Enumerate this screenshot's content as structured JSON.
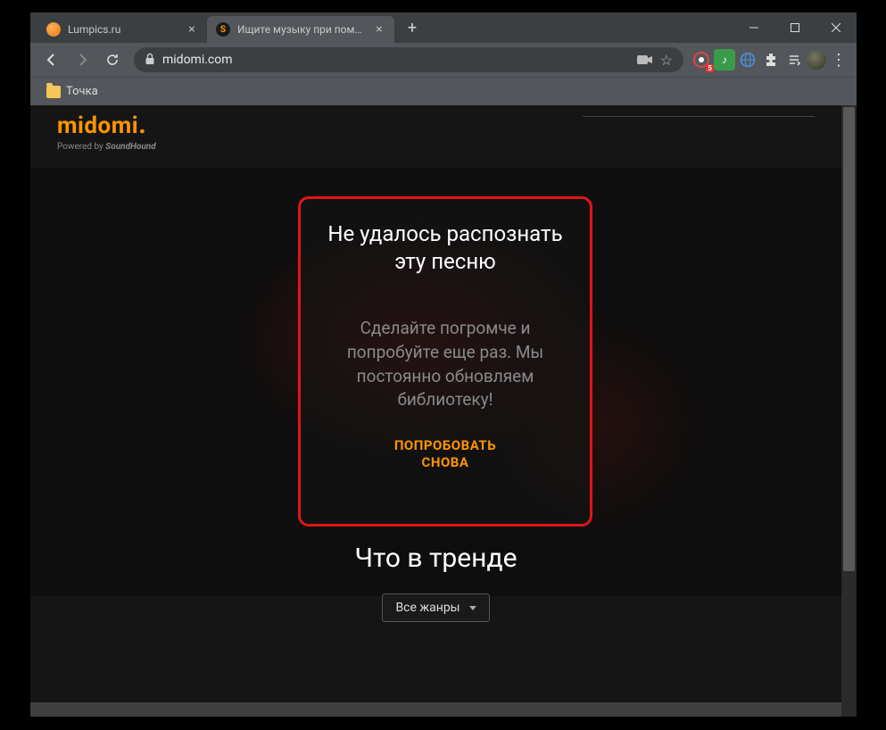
{
  "tabs": [
    {
      "title": "Lumpics.ru",
      "favicon": "orange"
    },
    {
      "title": "Ищите музыку при помощи гол",
      "favicon": "midomi"
    }
  ],
  "url": "midomi.com",
  "bookmark": {
    "label": "Точка"
  },
  "logo": {
    "text": "midomi",
    "powered": "Powered by ",
    "brand": "SoundHound"
  },
  "modal": {
    "title": "Не удалось распознать эту песню",
    "body": "Сделайте погромче и попробуйте еще раз. Мы постоянно обновляем библиотеку!",
    "action": "ПОПРОБОВАТЬ\nСНОВА"
  },
  "trending": {
    "title": "Что в тренде",
    "genre_label": "Все жанры"
  },
  "ext_badge": "5"
}
